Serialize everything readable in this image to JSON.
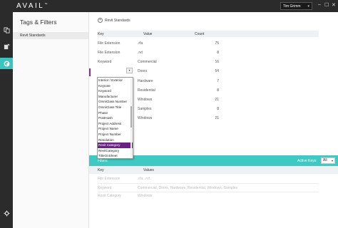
{
  "app": {
    "logo": "AVAIL",
    "tm": "™",
    "user": "Tim Grimm",
    "win_controls": [
      "–",
      "☐",
      "✕"
    ]
  },
  "rail": {
    "icons": [
      "files-icon",
      "tag-icon",
      "filter-icon"
    ],
    "bottom_icon": "gear-icon",
    "active_index": 2
  },
  "panel": {
    "title": "Tags & Filters",
    "items": [
      "Revit Standards"
    ]
  },
  "main": {
    "breadcrumb": "Revit Standards",
    "columns": {
      "key": "Key",
      "value": "Value",
      "count": "Count"
    },
    "rows": [
      {
        "key": "File Extension",
        "value": ".rfa",
        "count": "75"
      },
      {
        "key": "File Extension",
        "value": ".rvt",
        "count": "8"
      },
      {
        "key": "Keyword",
        "value": "Commercial",
        "count": "16"
      },
      {
        "key": "",
        "value": "Doors",
        "count": "54"
      },
      {
        "key": "",
        "value": "Hardware",
        "count": "7"
      },
      {
        "key": "",
        "value": "Residential",
        "count": "8"
      },
      {
        "key": "",
        "value": "Windows",
        "count": "21"
      },
      {
        "key": "",
        "value": "Samples",
        "count": "8"
      },
      {
        "key": "",
        "value": "Windows",
        "count": "21"
      }
    ]
  },
  "dropdown": {
    "options": [
      "Interior / Exterior",
      "Keynote",
      "Keyword",
      "Manufacturer",
      "OmniClass Number",
      "OmniClass Title",
      "Phase",
      "PostHash",
      "Project Address",
      "Project Name",
      "Project Number",
      "Resolution",
      "Revit Category",
      "RevitCategory",
      "TitleOnSheet"
    ],
    "selected_index": 12
  },
  "filters": {
    "label": "Filters",
    "active_keys_label": "Active Keys:",
    "active_keys_value": "All",
    "columns": {
      "key": "Key",
      "values": "Values"
    },
    "rows": [
      {
        "key": "File Extension",
        "values": ".rfa, .rvt"
      },
      {
        "key": "Keyword",
        "values": "Commercial, Doors, Hardware, Residential, Windows, Samples"
      },
      {
        "key": "Revit Category",
        "values": "Windows"
      }
    ]
  },
  "colors": {
    "accent": "#3ec9c3",
    "selection": "#6a2383",
    "titlebar": "#2b2b2b"
  }
}
